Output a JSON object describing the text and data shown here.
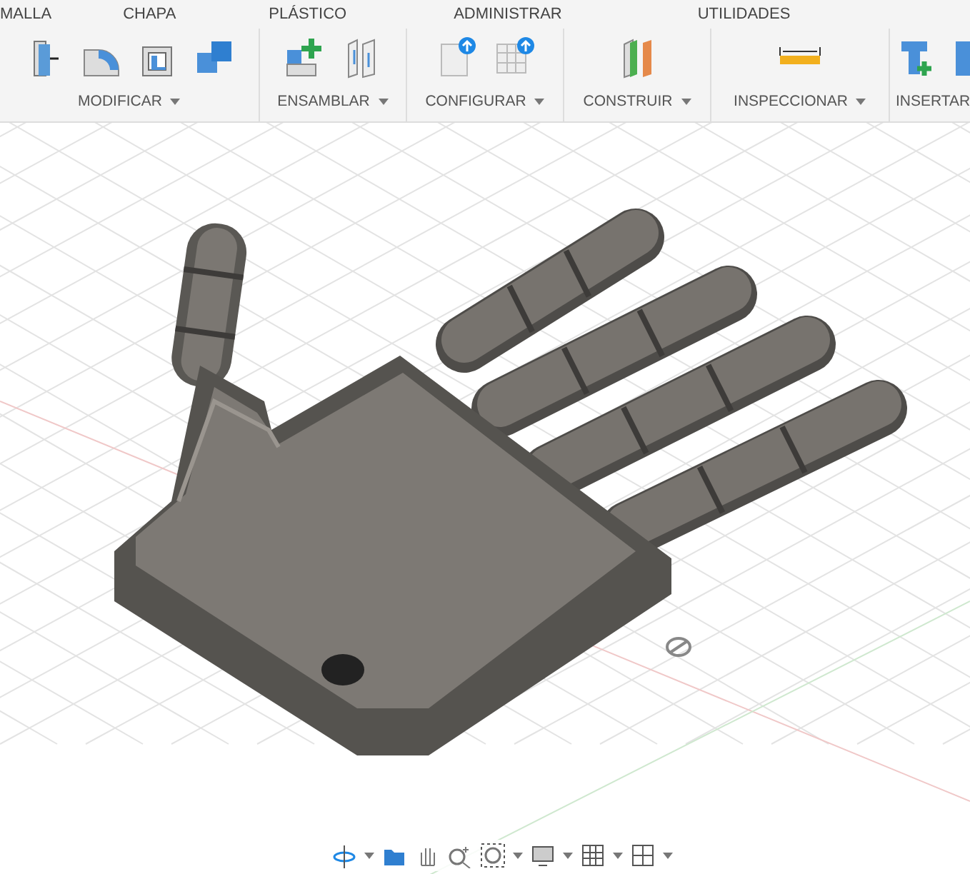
{
  "tabs": [
    {
      "label": "MALLA"
    },
    {
      "label": "CHAPA"
    },
    {
      "label": "PLÁSTICO"
    },
    {
      "label": "ADMINISTRAR"
    },
    {
      "label": "UTILIDADES"
    }
  ],
  "groups": [
    {
      "label": "MODIFICAR",
      "dropdown": true
    },
    {
      "label": "ENSAMBLAR",
      "dropdown": true
    },
    {
      "label": "CONFIGURAR",
      "dropdown": true
    },
    {
      "label": "CONSTRUIR",
      "dropdown": true
    },
    {
      "label": "INSPECCIONAR",
      "dropdown": true
    },
    {
      "label": "INSERTAR",
      "dropdown": false
    }
  ]
}
